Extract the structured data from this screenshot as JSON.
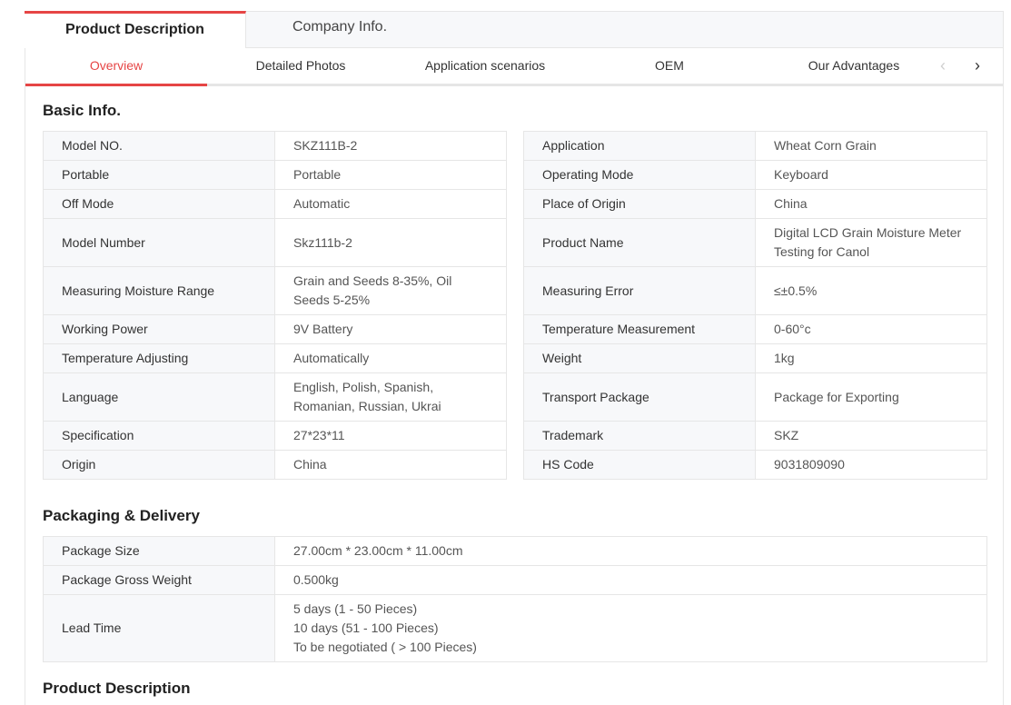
{
  "top_tabs": {
    "active": "Product Description",
    "inactive": "Company Info."
  },
  "sub_nav": {
    "items": [
      "Overview",
      "Detailed Photos",
      "Application scenarios",
      "OEM",
      "Our Advantages"
    ],
    "prev_glyph": "‹",
    "next_glyph": "›"
  },
  "basic_info": {
    "title": "Basic Info.",
    "left": [
      {
        "k": "Model NO.",
        "v": "SKZ111B-2"
      },
      {
        "k": "Portable",
        "v": "Portable"
      },
      {
        "k": "Off Mode",
        "v": "Automatic"
      },
      {
        "k": "Model Number",
        "v": "Skz111b-2"
      },
      {
        "k": "Measuring Moisture Range",
        "v": "Grain and Seeds 8-35%, Oil Seeds 5-25%"
      },
      {
        "k": "Working Power",
        "v": "9V Battery"
      },
      {
        "k": "Temperature Adjusting",
        "v": "Automatically"
      },
      {
        "k": "Language",
        "v": "English, Polish, Spanish, Romanian, Russian, Ukrai"
      },
      {
        "k": "Specification",
        "v": "27*23*11"
      },
      {
        "k": "Origin",
        "v": "China"
      }
    ],
    "right": [
      {
        "k": "Application",
        "v": "Wheat Corn Grain"
      },
      {
        "k": "Operating Mode",
        "v": "Keyboard"
      },
      {
        "k": "Place of Origin",
        "v": "China"
      },
      {
        "k": "Product Name",
        "v": "Digital LCD Grain Moisture Meter Testing for Canol"
      },
      {
        "k": "Measuring Error",
        "v": "≤±0.5%"
      },
      {
        "k": "Temperature Measurement",
        "v": "0-60°c"
      },
      {
        "k": "Weight",
        "v": "1kg"
      },
      {
        "k": "Transport Package",
        "v": "Package for Exporting"
      },
      {
        "k": "Trademark",
        "v": "SKZ"
      },
      {
        "k": "HS Code",
        "v": "9031809090"
      }
    ]
  },
  "packaging": {
    "title": "Packaging & Delivery",
    "rows": [
      {
        "k": "Package Size",
        "v": [
          "27.00cm * 23.00cm * 11.00cm"
        ]
      },
      {
        "k": "Package Gross Weight",
        "v": [
          "0.500kg"
        ]
      },
      {
        "k": "Lead Time",
        "v": [
          "5 days (1 - 50 Pieces)",
          "10 days (51 - 100 Pieces)",
          "To be negotiated ( > 100 Pieces)"
        ]
      }
    ]
  },
  "product_description": {
    "title": "Product Description"
  }
}
